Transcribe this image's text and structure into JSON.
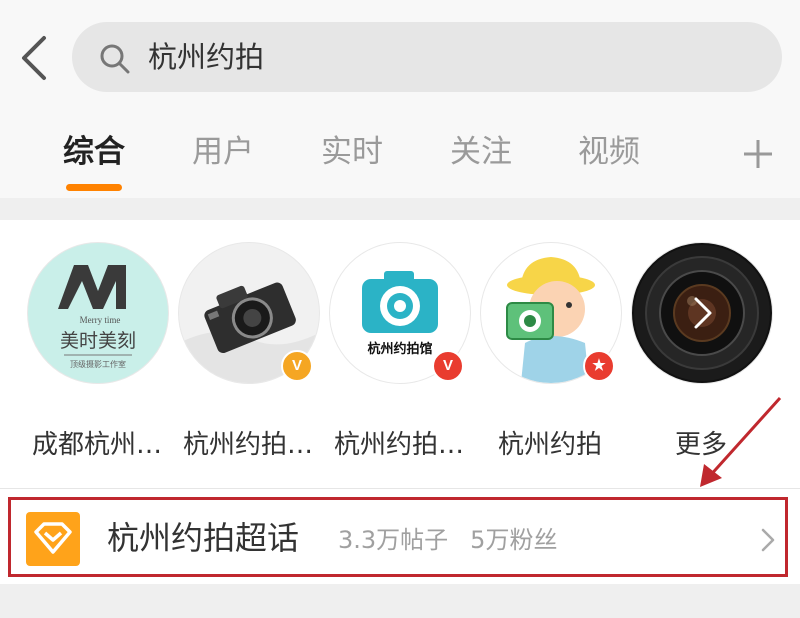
{
  "search": {
    "query": "杭州约拍"
  },
  "tabs": [
    {
      "label": "综合",
      "active": true
    },
    {
      "label": "用户",
      "active": false
    },
    {
      "label": "实时",
      "active": false
    },
    {
      "label": "关注",
      "active": false
    },
    {
      "label": "视频",
      "active": false
    }
  ],
  "users": [
    {
      "name": "成都杭州…",
      "avatar_logo": "M",
      "avatar_sub": "Merry time",
      "avatar_title": "美时美刻",
      "avatar_tagline": "顶级摄影工作室",
      "badge": ""
    },
    {
      "name": "杭州约拍…",
      "badge": "V",
      "badge_type": "gold"
    },
    {
      "name": "杭州约拍…",
      "avatar_text": "杭州约拍馆",
      "badge": "V",
      "badge_type": "red"
    },
    {
      "name": "杭州约拍",
      "badge": "★",
      "badge_type": "red"
    },
    {
      "name": "更多",
      "badge": ""
    }
  ],
  "super_topic": {
    "title": "杭州约拍超话",
    "posts": "3.3万帖子",
    "fans": "5万粉丝"
  },
  "colors": {
    "accent": "#ff8200",
    "topic_icon": "#ffa31a",
    "annotation": "#c0282e",
    "vip_gold": "#f5a623",
    "vip_red": "#e93c2f"
  }
}
